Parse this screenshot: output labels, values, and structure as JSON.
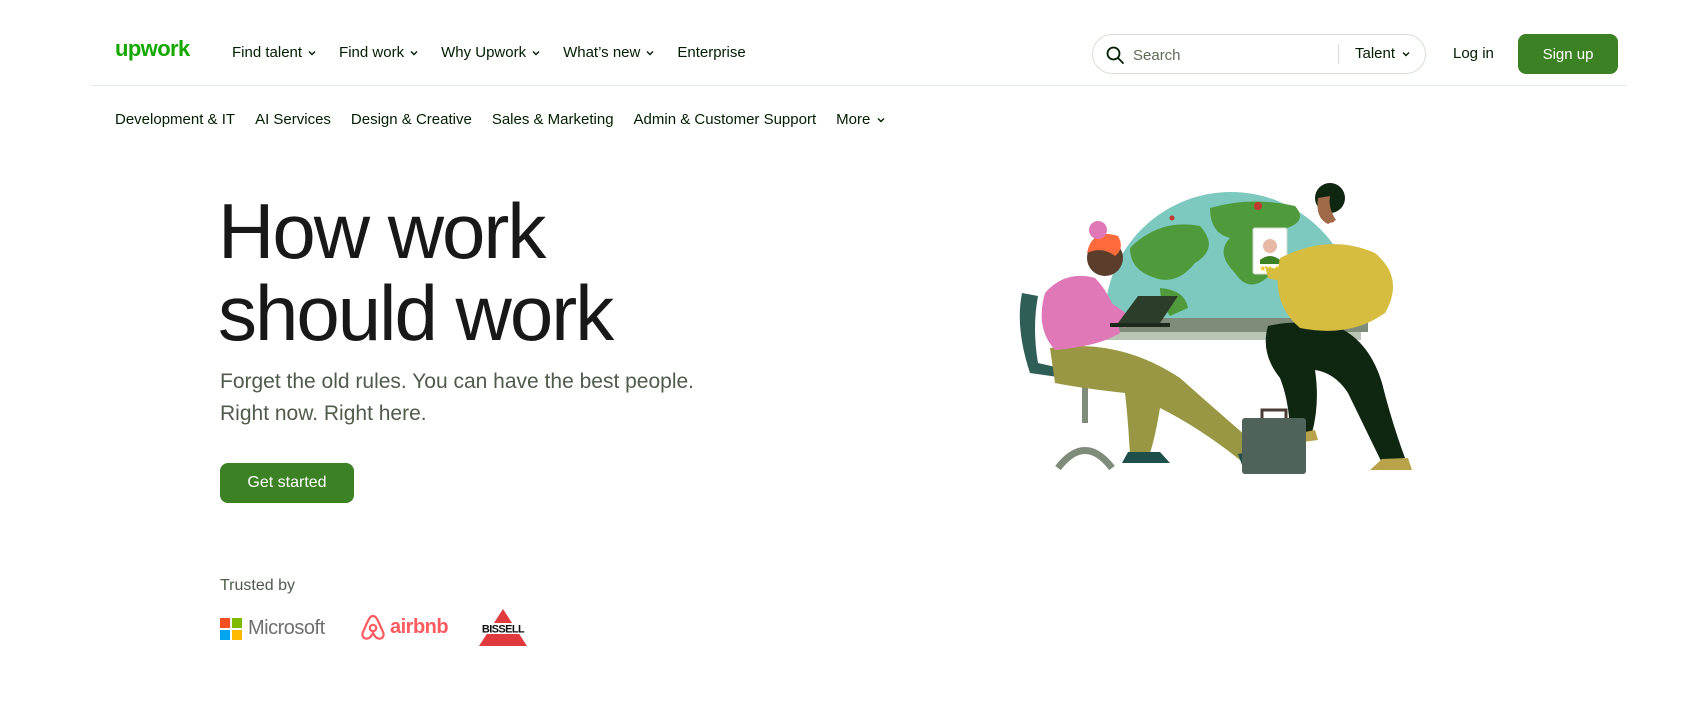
{
  "header": {
    "logo_text": "upwork",
    "nav": [
      {
        "label": "Find talent",
        "has_dropdown": true
      },
      {
        "label": "Find work",
        "has_dropdown": true
      },
      {
        "label": "Why Upwork",
        "has_dropdown": true
      },
      {
        "label": "What’s new",
        "has_dropdown": true
      },
      {
        "label": "Enterprise",
        "has_dropdown": false
      }
    ],
    "search": {
      "placeholder": "Search",
      "value": "",
      "scope": "Talent"
    },
    "login_label": "Log in",
    "signup_label": "Sign up"
  },
  "categories": [
    "Development & IT",
    "AI Services",
    "Design & Creative",
    "Sales & Marketing",
    "Admin & Customer Support",
    "More"
  ],
  "hero": {
    "title_lines": [
      "How work",
      "should work"
    ],
    "subtitle_lines": [
      "Forget the old rules. You can have the best people.",
      "Right now. Right here."
    ],
    "cta_label": "Get started"
  },
  "trusted": {
    "label": "Trusted by",
    "logos": [
      {
        "name": "microsoft-logo",
        "text": "Microsoft"
      },
      {
        "name": "airbnb-logo",
        "text": "airbnb"
      },
      {
        "name": "bissell-logo",
        "text": "BISSELL"
      }
    ]
  },
  "icons": {
    "search": "search-icon",
    "dropdown": "chevron-down-icon",
    "illustration": "hero-illustration-freelancer-client-globe"
  },
  "colors": {
    "brand_green": "#3c8224",
    "logo_green": "#14a800",
    "text_dark": "#001e00",
    "airbnb": "#ff5a5f",
    "bissell_red": "#e03a3e"
  }
}
